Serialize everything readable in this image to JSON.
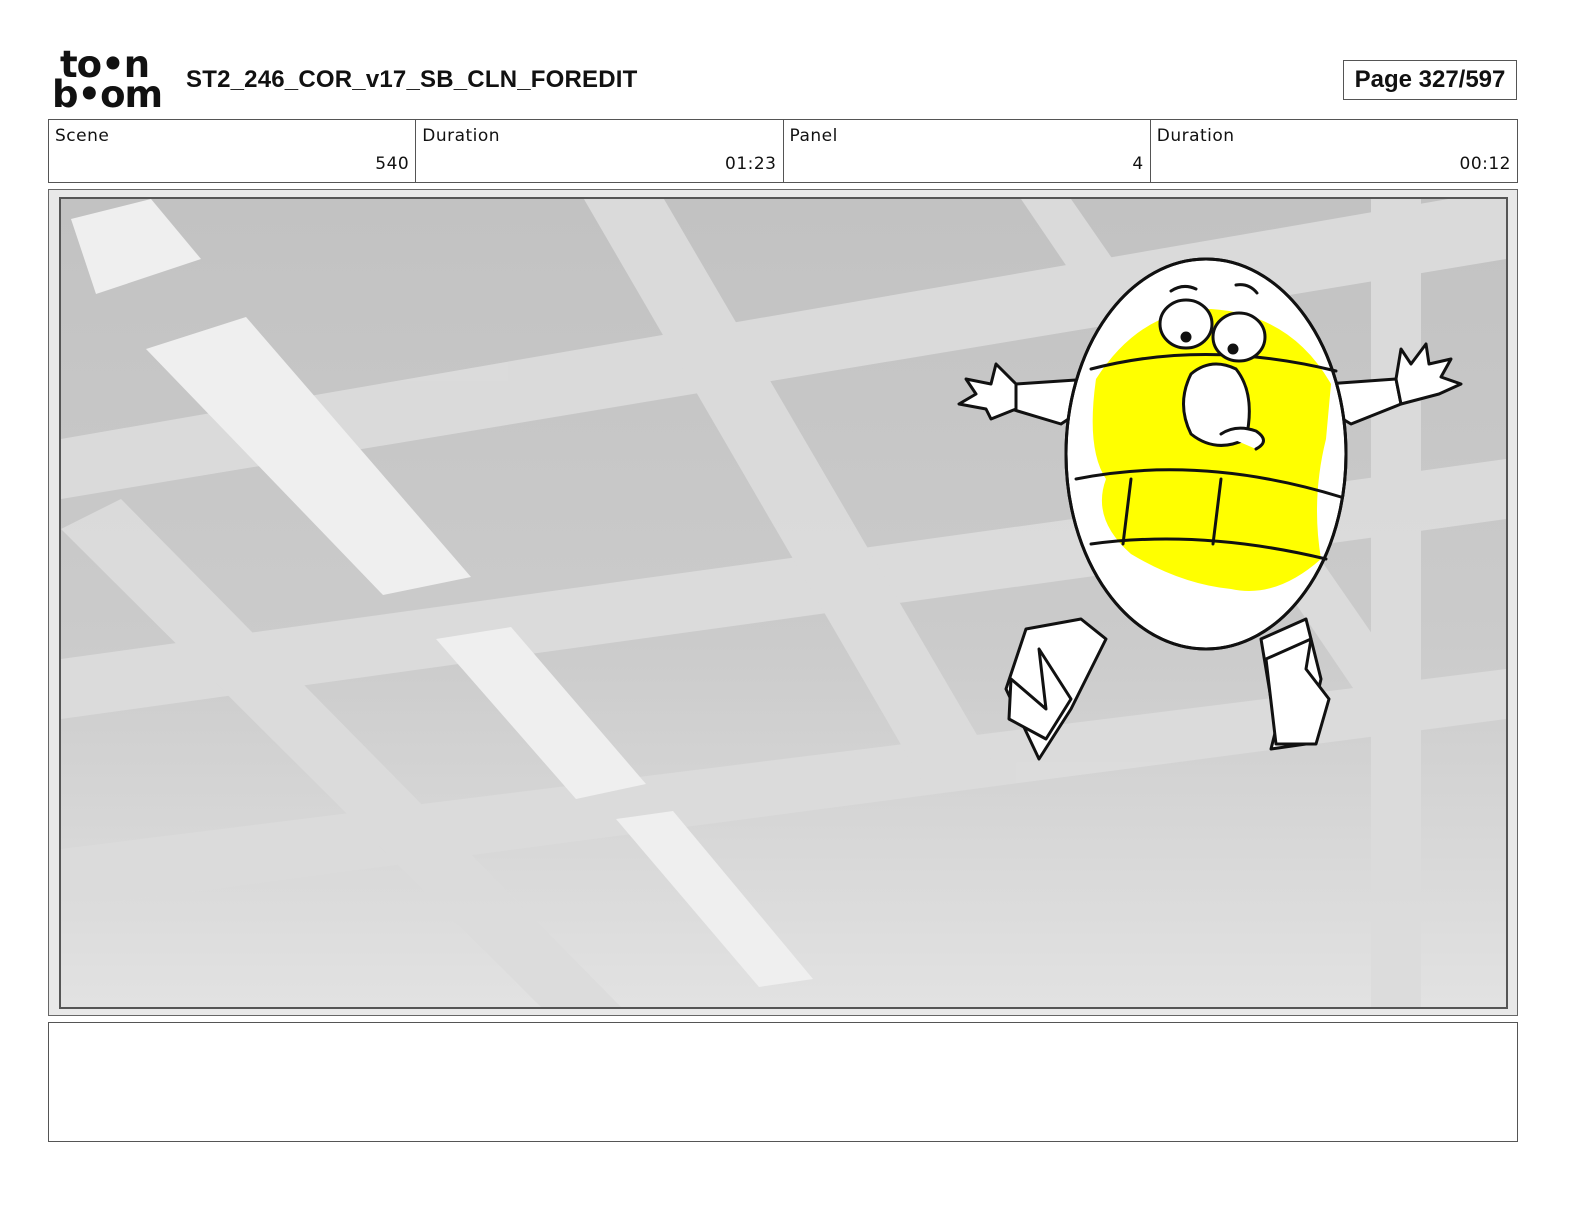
{
  "header": {
    "logo_line1": "to•n",
    "logo_line2": "b•om",
    "title": "ST2_246_COR_v17_SB_CLN_FOREDIT",
    "page_label": "Page 327/597"
  },
  "info": {
    "scene_label": "Scene",
    "scene_value": "540",
    "scene_duration_label": "Duration",
    "scene_duration_value": "01:23",
    "panel_label": "Panel",
    "panel_value": "4",
    "panel_duration_label": "Duration",
    "panel_duration_value": "00:12"
  },
  "notes": {
    "text": ""
  },
  "colors": {
    "character_fill": "#ffff00",
    "ceiling_gray": "#c8c8c8",
    "beam_light": "#dedede",
    "light_panel": "#eeeeee"
  }
}
